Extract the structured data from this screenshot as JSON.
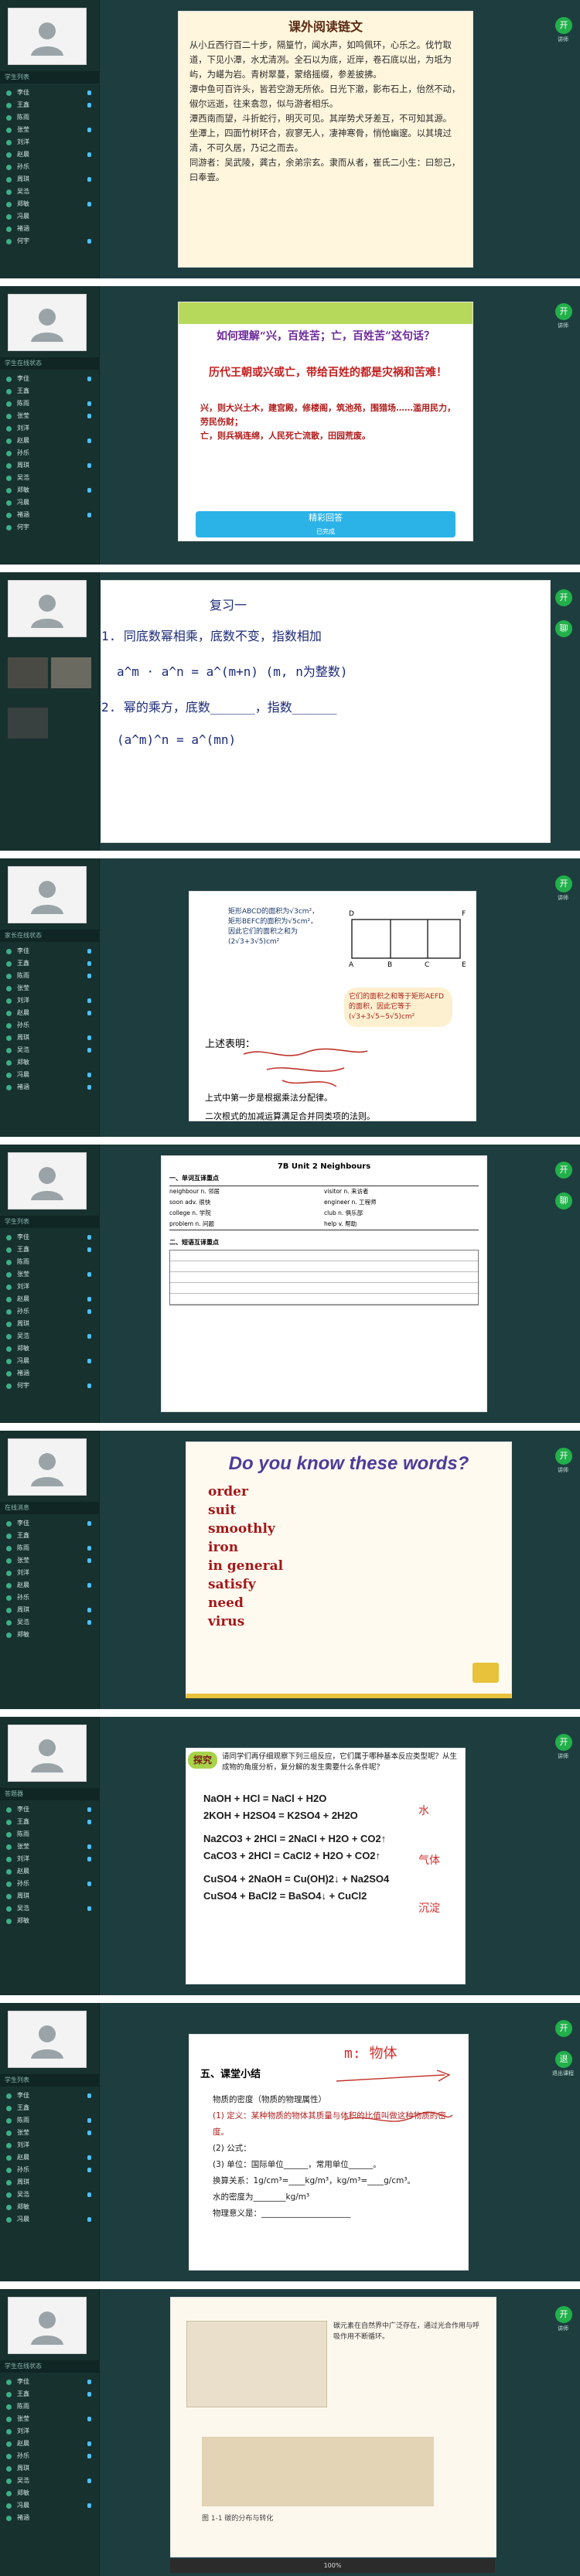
{
  "sidebar": {
    "tab_labels": [
      "学生列表",
      "学生在线状态",
      "家长在线状态",
      "在线消息",
      "答题器"
    ],
    "entries": [
      "李佳",
      "王鑫",
      "陈雨",
      "张莹",
      "刘洋",
      "赵晨",
      "孙乐",
      "周琪",
      "吴浩",
      "郑敏",
      "冯晨",
      "褚涵",
      "何宇",
      "吕可"
    ]
  },
  "right_panel": {
    "buttons": [
      "开",
      "聊",
      "退"
    ],
    "labels": [
      "讲师",
      "连线学生",
      "退出课程"
    ]
  },
  "slide1": {
    "title": "课外阅读链文",
    "paras": [
      "从小丘西行百二十步，隔篁竹，闻水声，如鸣佩环，心乐之。伐竹取道，下见小潭，水尤清冽。全石以为底，近岸，卷石底以出，为坻为屿，为嵁为岩。青树翠蔓，蒙络摇缀，参差披拂。",
      "潭中鱼可百许头，皆若空游无所依。日光下澈，影布石上，佁然不动，俶尔远逝，往来翕忽，似与游者相乐。",
      "潭西南而望，斗折蛇行，明灭可见。其岸势犬牙差互，不可知其源。",
      "坐潭上，四面竹树环合，寂寥无人，凄神寒骨，悄怆幽邃。以其境过清，不可久居，乃记之而去。"
    ],
    "footer": "同游者：吴武陵，龚古，余弟宗玄。隶而从者，崔氏二小生：曰恕己，曰奉壹。"
  },
  "slide2": {
    "question": "如何理解“兴，百姓苦；亡，百姓苦”这句话？",
    "answer": "历代王朝或兴或亡，带给百姓的都是灾祸和苦难！",
    "line1": "兴，则大兴土木，建宫殿，修楼阁，筑池苑，围猎场……滥用民力，劳民伤财；",
    "line2": "亡，则兵祸连绵，人民死亡流散，田园荒废。",
    "panel_title": "精彩回答",
    "panel_sub": "已完成"
  },
  "slide3": {
    "lines": [
      "复习一",
      "1. 同底数幂相乘，底数不变，指数相加",
      "a^m · a^n = a^(m+n)   (m, n为整数)",
      "2. 幂的乘方，底数______，指数______",
      "(a^m)^n = a^(mn)"
    ]
  },
  "slide4": {
    "t1": "矩形ABCD的面积为√3cm²，矩形BEFC的面积为√5cm²，因此它们的面积之和为(2√3+3√5)cm²",
    "t2": "它们的面积之和等于矩形AEFD的面积，因此它等于(√3+3√5−5√5)cm²",
    "conclusion": "上述表明：",
    "body": "上式中第一步是根据乘法分配律。",
    "rule": "二次根式的加减运算满足合并同类项的法则。",
    "labels": [
      "A",
      "B",
      "C",
      "D",
      "E",
      "F"
    ]
  },
  "slide5": {
    "title": "7B Unit 2 Neighbours",
    "section1": "一、单词互译重点",
    "section2": "二、短语互译重点",
    "rows": [
      "neighbour n. 邻居",
      "visitor n. 来访者",
      "soon adv. 很快",
      "engineer n. 工程师",
      "college n. 学院",
      "club n. 俱乐部",
      "problem n. 问题",
      "help v. 帮助"
    ]
  },
  "slide6": {
    "title": "Do you know these words?",
    "words": [
      "order",
      "suit",
      "smoothly",
      "iron",
      "in general",
      "satisfy",
      "need",
      "virus"
    ]
  },
  "slide7": {
    "intro": "请同学们再仔细观察下列三组反应，它们属于哪种基本反应类型呢？从生成物的角度分析，复分解的发生需要什么条件呢？",
    "tag": "探究",
    "rows": [
      "NaOH + HCl = NaCl + H2O",
      "2KOH + H2SO4 = K2SO4 + 2H2O",
      "Na2CO3 + 2HCl = 2NaCl + H2O + CO2↑",
      "CaCO3 + 2HCl = CaCl2 + H2O + CO2↑",
      "CuSO4 + 2NaOH = Cu(OH)2↓ + Na2SO4",
      "CuSO4 + BaCl2 = BaSO4↓ + CuCl2"
    ],
    "notes": [
      "水",
      "气体",
      "沉淀"
    ]
  },
  "slide8": {
    "header": "五、课堂小结",
    "lines": [
      "物质的密度（物质的物理属性）",
      "(1) 定义：某种物质的物体其质量与体积的比值叫做这种物质的密度。",
      "(2) 公式：",
      "(3) 单位：国际单位______，常用单位______。",
      "换算关系：1g/cm³=____kg/m³，kg/m³=____g/cm³。",
      "水的密度为________kg/m³",
      "物理意义是：______________________"
    ],
    "hand": "m: 物体"
  },
  "slide9": {
    "caption": "图 1-1 碳的分布与转化",
    "text": "碳元素在自然界中广泛存在，通过光合作用与呼吸作用不断循环。",
    "zoom": "100%"
  }
}
